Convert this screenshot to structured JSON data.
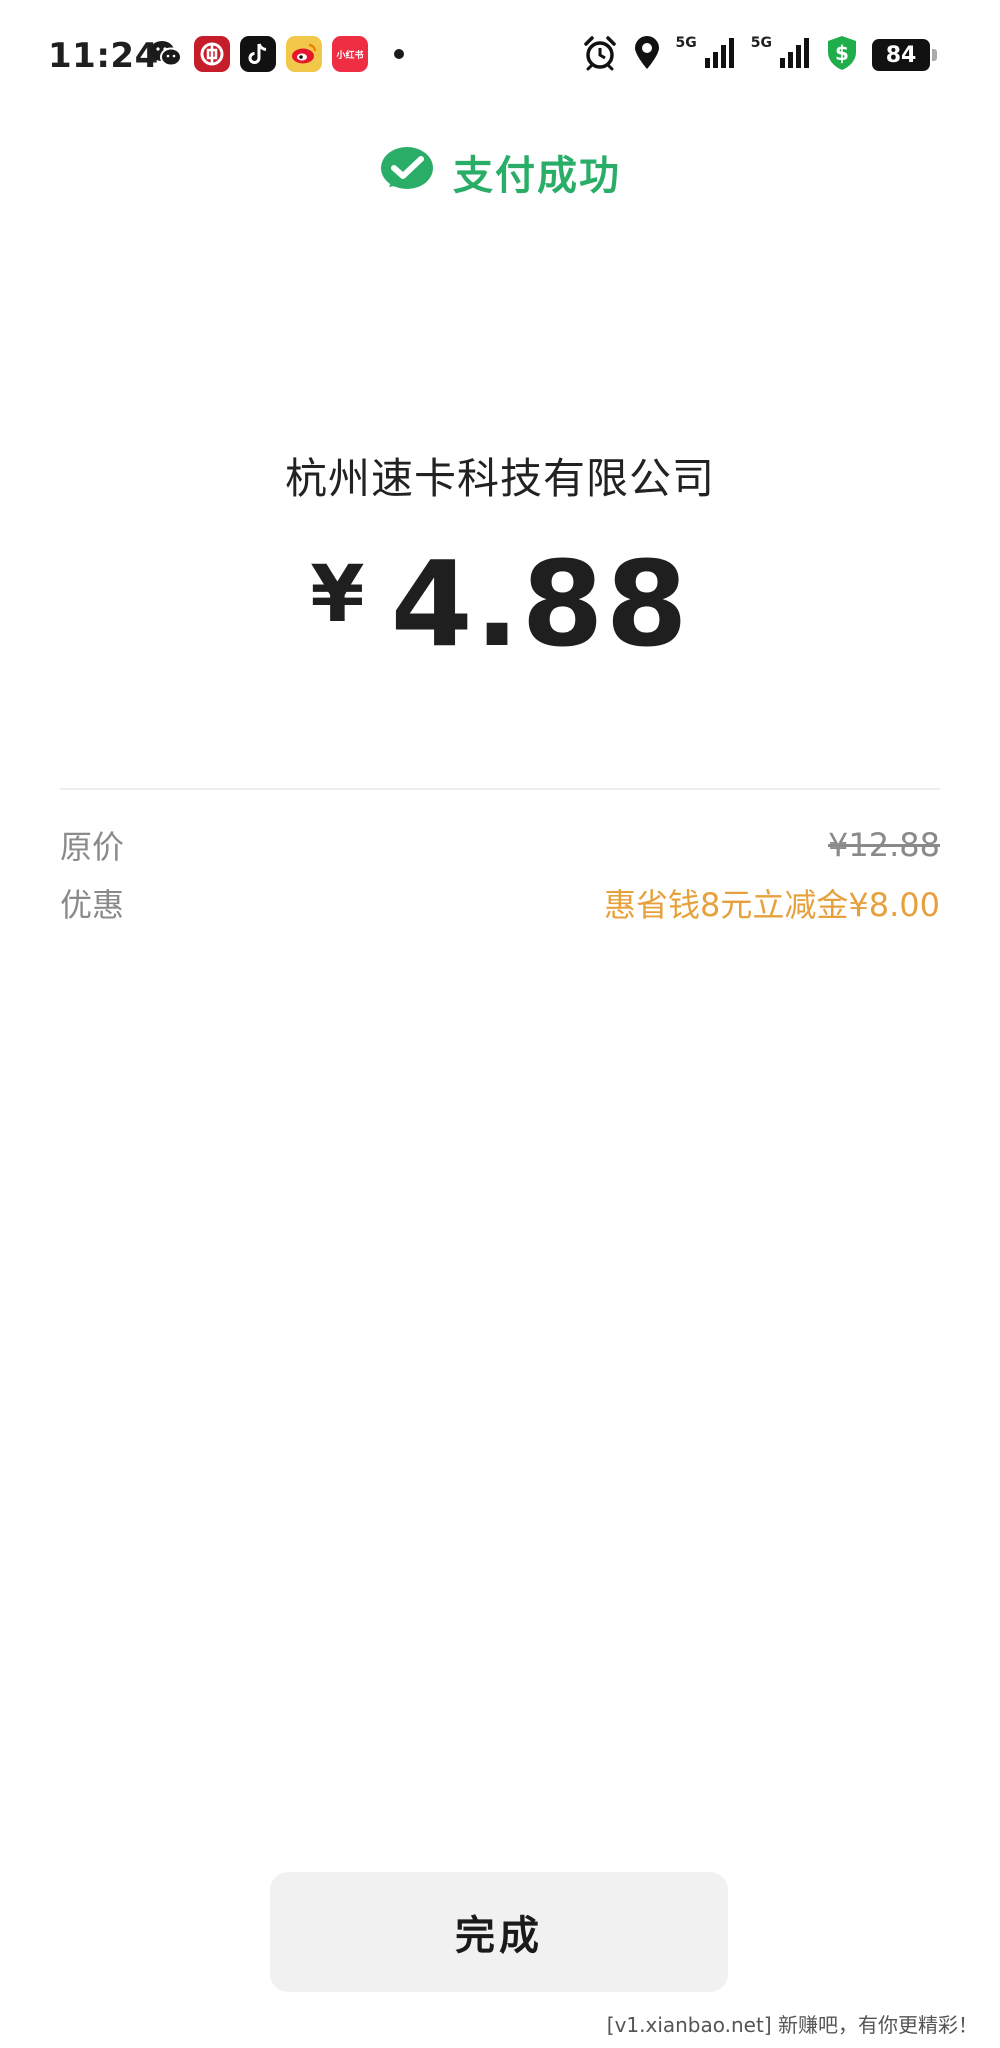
{
  "status_bar": {
    "time": "11:24",
    "apps": [
      "wechat-icon",
      "bank-icon",
      "tiktok-icon",
      "weibo-icon",
      "redbook-icon"
    ],
    "redbook_label": "小红书",
    "signal_1_label": "5G",
    "signal_2_label": "5G",
    "battery": "84",
    "icons": [
      "alarm-icon",
      "location-icon",
      "signal-icon",
      "signal-icon",
      "shield-dollar-icon",
      "battery-icon"
    ]
  },
  "header": {
    "title": "支付成功",
    "icon": "wechat-pay-icon",
    "color": "#2aae67"
  },
  "payment": {
    "merchant": "杭州速卡科技有限公司",
    "currency_symbol": "¥",
    "amount": "4.88"
  },
  "details": {
    "original_label": "原价",
    "original_value": "¥12.88",
    "discount_label": "优惠",
    "discount_value": "惠省钱8元立减金¥8.00",
    "discount_color": "#e6a13c"
  },
  "actions": {
    "done_label": "完成"
  },
  "watermark": "[v1.xianbao.net] 新赚吧，有你更精彩！"
}
